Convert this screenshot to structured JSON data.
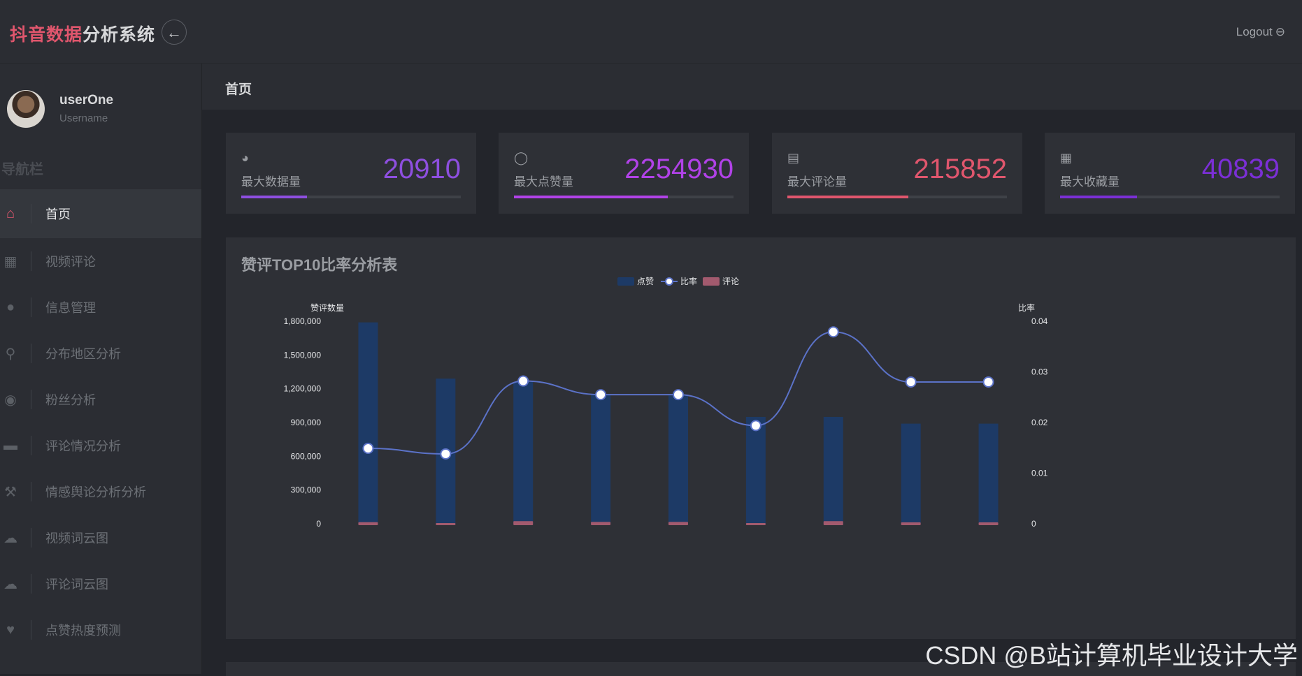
{
  "app": {
    "title_part1": "抖音数据",
    "title_part2": "分析系统",
    "back_icon": "arrow-left-icon"
  },
  "header": {
    "logout_label": "Logout",
    "logout_icon": "logout-icon"
  },
  "user": {
    "name": "userOne",
    "role": "Username"
  },
  "sidebar": {
    "title": "导航栏",
    "items": [
      {
        "label": "首页",
        "icon": "home-icon",
        "active": true
      },
      {
        "label": "视频评论",
        "icon": "grid-icon",
        "active": false
      },
      {
        "label": "信息管理",
        "icon": "user-icon",
        "active": false
      },
      {
        "label": "分布地区分析",
        "icon": "map-pin-icon",
        "active": false
      },
      {
        "label": "粉丝分析",
        "icon": "users-icon",
        "active": false
      },
      {
        "label": "评论情况分析",
        "icon": "comment-icon",
        "active": false
      },
      {
        "label": "情感舆论分析分析",
        "icon": "gavel-icon",
        "active": false
      },
      {
        "label": "视频词云图",
        "icon": "cloud-icon",
        "active": false
      },
      {
        "label": "评论词云图",
        "icon": "cloud-icon",
        "active": false
      },
      {
        "label": "点赞热度预测",
        "icon": "heart-icon",
        "active": false
      }
    ]
  },
  "page": {
    "title": "首页"
  },
  "stats": [
    {
      "label": "最大数据量",
      "value": "20910",
      "color": "#8e4fe0",
      "fill_fraction": 0.3,
      "icon": "dashboard-icon"
    },
    {
      "label": "最大点赞量",
      "value": "2254930",
      "color": "#b142e8",
      "fill_fraction": 0.7,
      "icon": "bulb-icon"
    },
    {
      "label": "最大评论量",
      "value": "215852",
      "color": "#e0566d",
      "fill_fraction": 0.55,
      "icon": "document-icon"
    },
    {
      "label": "最大收藏量",
      "value": "40839",
      "color": "#7b2fd6",
      "fill_fraction": 0.35,
      "icon": "grid-icon"
    }
  ],
  "chart_panel": {
    "title": "赞评TOP10比率分析表"
  },
  "chart_data": {
    "type": "bar",
    "title": "",
    "categories": [
      "",
      "",
      "",
      "",
      "",
      "",
      "",
      "",
      ""
    ],
    "series": [
      {
        "name": "点赞",
        "type": "bar",
        "axis": "left",
        "color": "#1d3a66",
        "values": [
          1790000,
          1290000,
          1260000,
          1150000,
          1140000,
          950000,
          950000,
          890000,
          890000
        ]
      },
      {
        "name": "比率",
        "type": "line",
        "axis": "right",
        "color": "#5b72c8",
        "values": [
          0.0149,
          0.0138,
          0.0282,
          0.0255,
          0.0255,
          0.0194,
          0.0379,
          0.028,
          0.028
        ]
      },
      {
        "name": "评论",
        "type": "bar",
        "axis": "left",
        "color": "#a25a6e",
        "values": [
          26000,
          18000,
          36000,
          29000,
          29000,
          18000,
          36000,
          25000,
          25000
        ]
      }
    ],
    "ylabel_left": "赞评数量",
    "ylabel_right": "比率",
    "ylim_left": [
      0,
      1800000
    ],
    "ylim_right": [
      0,
      0.04
    ],
    "yticks_left": [
      "0",
      "300,000",
      "600,000",
      "900,000",
      "1,200,000",
      "1,500,000",
      "1,800,000"
    ],
    "yticks_right": [
      "0",
      "0.01",
      "0.02",
      "0.03",
      "0.04"
    ],
    "legend_position": "top-center",
    "grid": false
  },
  "watermark": "CSDN @B站计算机毕业设计大学"
}
